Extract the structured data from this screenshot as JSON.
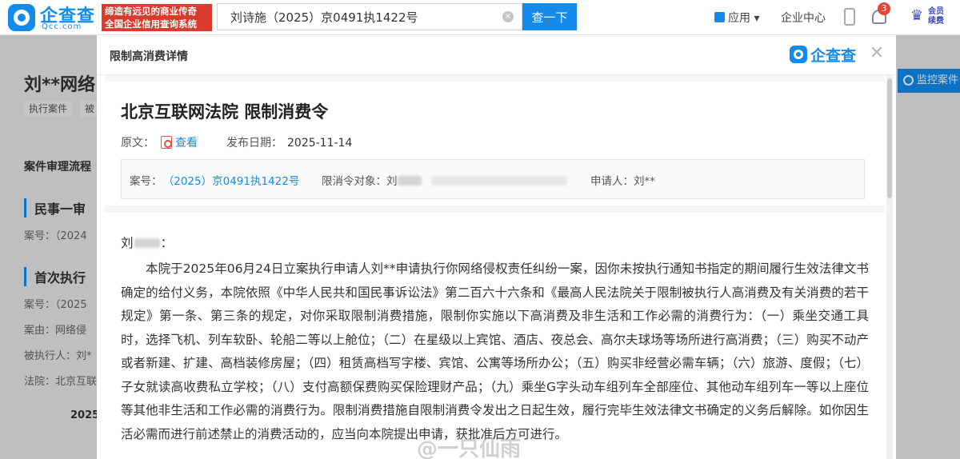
{
  "topbar": {
    "logo_text": "企查查",
    "logo_sub": "Qcc.com",
    "slogan": [
      "缔造有远见的商业传奇",
      "全国企业信用查询系统"
    ],
    "search_value": "刘诗施（2025）京0491执1422号",
    "search_button": "查一下",
    "nav_app": "应用 ▾",
    "nav_center": "企业中心",
    "bell_count": "3",
    "vip": [
      "会员",
      "续费"
    ]
  },
  "background_page": {
    "company_title": "刘**网络",
    "tags": [
      "执行案件",
      "被"
    ],
    "section_title": "案件审理流程",
    "stage1": "民事一审",
    "stage1_lines": [
      "案号：（2024"
    ],
    "stage2": "首次执行",
    "stage2_lines": [
      "案号：（2025",
      "案由：网络侵",
      "被执行人：刘*",
      "法院：北京互联"
    ],
    "year": "2025",
    "monitor_button": "监控案件"
  },
  "modal": {
    "header_title": "限制高消费详情",
    "brand": "企查查",
    "doc_title": "北京互联网法院 限制消费令",
    "original_label": "原文：",
    "view_link": "查看",
    "publish_label": "发布日期：",
    "publish_date": "2025-11-14",
    "case_no_label": "案号：",
    "case_no": "（2025）京0491执1422号",
    "target_label": "限消令对象：刘",
    "applicant_label": "申请人：刘**",
    "salutation_prefix": "刘",
    "salutation_suffix": "：",
    "body": "本院于2025年06月24日立案执行申请人刘**申请执行你网络侵权责任纠纷一案，因你未按执行通知书指定的期间履行生效法律文书确定的给付义务，本院依照《中华人民共和国民事诉讼法》第二百六十六条和《最高人民法院关于限制被执行人高消费及有关消费的若干规定》第一条、第三条的规定，对你采取限制消费措施，限制你实施以下高消费及非生活和工作必需的消费行为：（一）乘坐交通工具时，选择飞机、列车软卧、轮船二等以上舱位；（二）在星级以上宾馆、酒店、夜总会、高尔夫球场等场所进行高消费；（三）购买不动产或者新建、扩建、高档装修房屋；（四）租赁高档写字楼、宾馆、公寓等场所办公；（五）购买非经营必需车辆；（六）旅游、度假；（七）子女就读高收费私立学校；（八）支付高额保费购买保险理财产品；（九）乘坐G字头动车组列车全部座位、其他动车组列车一等以上座位等其他非生活和工作必需的消费行为。限制消费措施自限制消费令发出之日起生效，履行完毕生效法律文书确定的义务后解除。如你因生活必需而进行前述禁止的消费活动的，应当向本院提出申请，获批准后方可进行。",
    "watermark": "@一只仙雨"
  }
}
